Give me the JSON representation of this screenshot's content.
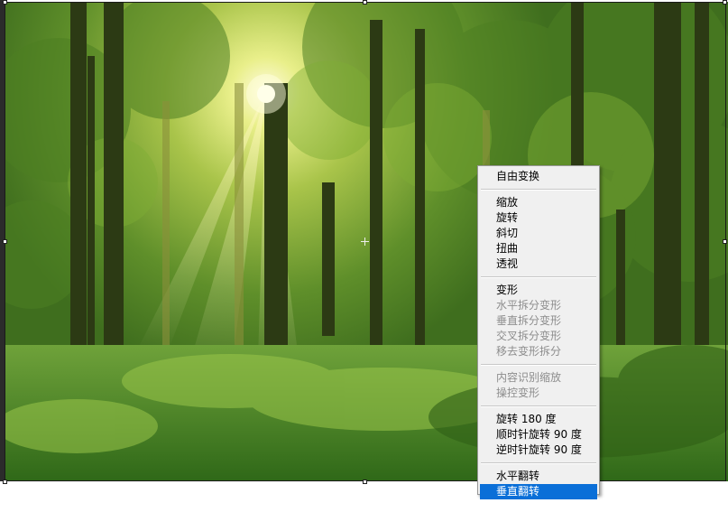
{
  "menu": {
    "free_transform": "自由变换",
    "scale": "缩放",
    "rotate": "旋转",
    "skew": "斜切",
    "distort": "扭曲",
    "perspective": "透视",
    "warp": "变形",
    "split_warp_horizontal": "水平拆分变形",
    "split_warp_vertical": "垂直拆分变形",
    "split_warp_crosswise": "交叉拆分变形",
    "remove_warp_split": "移去变形拆分",
    "content_aware_scale": "内容识别缩放",
    "puppet_warp": "操控变形",
    "rotate_180": "旋转 180 度",
    "rotate_90_cw": "顺时针旋转 90 度",
    "rotate_90_ccw": "逆时针旋转 90 度",
    "flip_horizontal": "水平翻转",
    "flip_vertical": "垂直翻转"
  },
  "colors": {
    "menu_highlight": "#0a6fd8",
    "menu_background": "#f0f0f0",
    "disabled_text": "#8d8d8d"
  }
}
